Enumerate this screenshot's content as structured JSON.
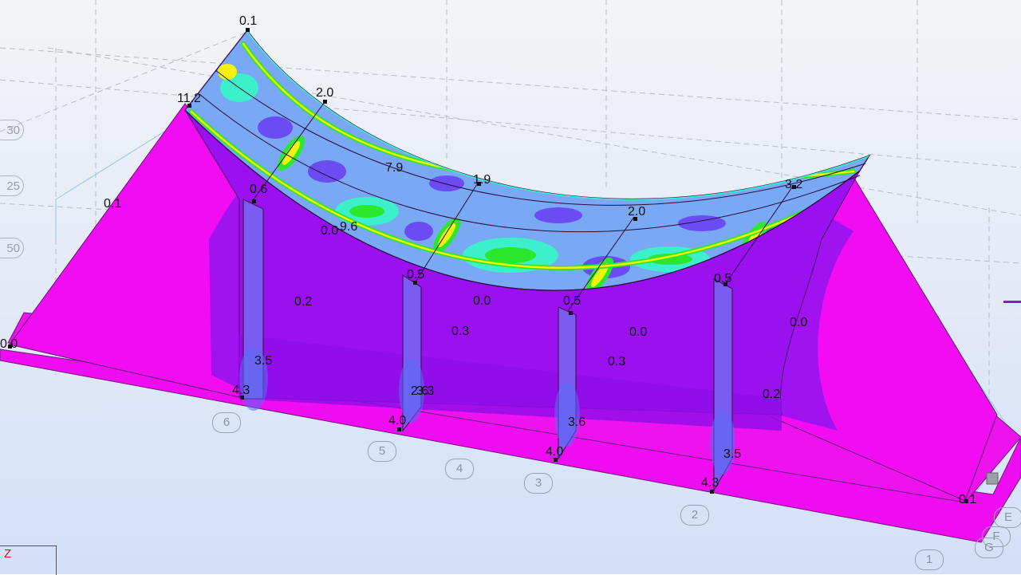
{
  "values": [
    {
      "id": "v01",
      "text": "0.1"
    },
    {
      "id": "v02",
      "text": "11.2"
    },
    {
      "id": "v03",
      "text": "2.0"
    },
    {
      "id": "v04",
      "text": "7.9"
    },
    {
      "id": "v05",
      "text": "1.9"
    },
    {
      "id": "v06",
      "text": "0.6"
    },
    {
      "id": "v07",
      "text": "0.1"
    },
    {
      "id": "v08",
      "text": "0.0"
    },
    {
      "id": "v09",
      "text": "9.6"
    },
    {
      "id": "v10",
      "text": "2.0"
    },
    {
      "id": "v11",
      "text": "3.2"
    },
    {
      "id": "v12",
      "text": "0.5"
    },
    {
      "id": "v13",
      "text": "0.2"
    },
    {
      "id": "v14",
      "text": "0.0"
    },
    {
      "id": "v15",
      "text": "0.5"
    },
    {
      "id": "v16",
      "text": "0.5"
    },
    {
      "id": "v17",
      "text": "0.3"
    },
    {
      "id": "v18",
      "text": "0.0"
    },
    {
      "id": "v19",
      "text": "0.0"
    },
    {
      "id": "v20",
      "text": "0.0"
    },
    {
      "id": "v21",
      "text": "3.5"
    },
    {
      "id": "v22",
      "text": "0.3"
    },
    {
      "id": "v23",
      "text": "4.3"
    },
    {
      "id": "v24",
      "text": "2.6"
    },
    {
      "id": "v25",
      "text": "3.3"
    },
    {
      "id": "v26",
      "text": "0.2"
    },
    {
      "id": "v27",
      "text": "4.0"
    },
    {
      "id": "v28",
      "text": "3.6"
    },
    {
      "id": "v29",
      "text": "4.0"
    },
    {
      "id": "v30",
      "text": "3.5"
    },
    {
      "id": "v31",
      "text": "4.3"
    },
    {
      "id": "v32",
      "text": "0.1"
    }
  ],
  "grid_axes": [
    "6",
    "5",
    "4",
    "3",
    "2",
    "1"
  ],
  "grid_rows": [
    "E",
    "F",
    "G"
  ],
  "levels": [
    "30",
    "25",
    "50"
  ],
  "axis": {
    "z": "Z"
  },
  "colors": {
    "background_top": "#f2f3f6",
    "background_bottom": "#d6e2f7",
    "magenta": "#f00cf0",
    "violet": "#9a10f0",
    "blue_violet": "#6a4cf2",
    "light_blue": "#79a8f4",
    "cyan": "#3cf0cc",
    "green": "#2ce82c",
    "yellow": "#f2f20a"
  }
}
